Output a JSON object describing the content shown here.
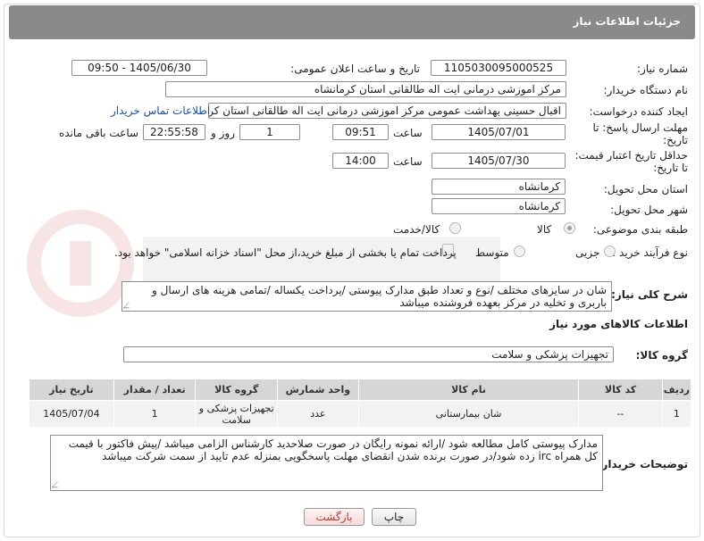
{
  "header": {
    "title": "جزئیات اطلاعات نیاز"
  },
  "fields": {
    "need_number": {
      "label": "شماره نیاز:",
      "value": "1105030095000525"
    },
    "announce": {
      "label": "تاریخ و ساعت اعلان عمومی:",
      "value": "1405/06/30 - 09:50"
    },
    "buyer": {
      "label": "نام دستگاه خریدار:",
      "value": "مرکز اموزشی درمانی ایت اله طالقانی استان کرمانشاه"
    },
    "requester": {
      "label": "ایجاد کننده درخواست:",
      "value": "اقبال حسینی بهداشت عمومی مرکز اموزشی درمانی ایت اله طالقانی استان کرمانشاه"
    },
    "contact_link": "اطلاعات تماس خریدار",
    "deadline": {
      "label_line1": "مهلت ارسال پاسخ: تا",
      "label_line2": "تاریخ:",
      "date": "1405/07/01",
      "time_label": "ساعت",
      "time": "09:51",
      "days": "1",
      "days_label": "روز و",
      "remaining": "22:55:58",
      "remaining_label": "ساعت باقی مانده"
    },
    "price_validity": {
      "label_line1": "حداقل تاریخ اعتبار قیمت:",
      "label_line2": "تا تاریخ:",
      "date": "1405/07/30",
      "time_label": "ساعت",
      "time": "14:00"
    },
    "province": {
      "label": "استان محل تحویل:",
      "value": "کرمانشاه"
    },
    "city": {
      "label": "شهر محل تحویل:",
      "value": "کرمانشاه"
    },
    "category": {
      "label": "طبقه بندی موضوعی:",
      "options": [
        "کالا",
        "کالا/خدمت"
      ],
      "selected": "کالا"
    },
    "process": {
      "label": "نوع فرآیند خرید :",
      "options": [
        "جزیی",
        "متوسط"
      ],
      "payment_note": "پرداخت تمام یا بخشی از مبلغ خرید،از محل \"اسناد خزانه اسلامی\" خواهد بود."
    }
  },
  "description": {
    "label": "شرح کلی نیاز:",
    "text": "شان در سایزهای مختلف /نوع و تعداد طبق مدارک پیوستی /پرداخت یکساله /تمامی هزینه های ارسال و باربری و تخلیه در مرکز بعهده فروشنده میباشد"
  },
  "goods_section": {
    "title": "اطلاعات کالاهای مورد نیاز"
  },
  "goods_group": {
    "label": "گروه کالا:",
    "value": "تجهیزات پزشکی و سلامت"
  },
  "table": {
    "headers": [
      "ردیف",
      "کد کالا",
      "نام کالا",
      "واحد شمارش",
      "گروه کالا",
      "تعداد / مقدار",
      "تاریخ نیاز"
    ],
    "rows": [
      [
        "1",
        "--",
        "شان بیمارستانی",
        "عدد",
        "تجهیزات پزشکی و سلامت",
        "1",
        "1405/07/04"
      ]
    ]
  },
  "buyer_notes": {
    "label": "توضیحات خریدار:",
    "text": "مدارک پیوستی کامل مطالعه شود /ارائه نمونه رایگان در صورت صلاحدید کارشناس الزامی میباشد /پیش فاکتور با قیمت کل همراه irc زده شود/در صورت برنده شدن انقضای مهلت پاسخگویی بمنزله عدم تایید از سمت شرکت میباشد"
  },
  "buttons": {
    "print": "چاپ",
    "back": "بازگشت"
  },
  "colors": {
    "header_bg": "#8a8a8a",
    "link": "#1a4fa3",
    "back_text": "#c0392b"
  }
}
